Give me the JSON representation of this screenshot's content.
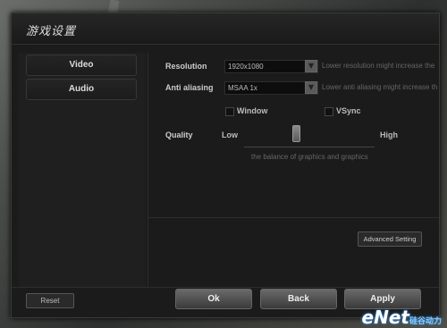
{
  "window": {
    "title": "游戏设置"
  },
  "sidebar": {
    "items": [
      {
        "label": "Video"
      },
      {
        "label": "Audio"
      }
    ]
  },
  "video": {
    "resolution": {
      "label": "Resolution",
      "value": "1920x1080",
      "hint": "Lower resolution might increase the"
    },
    "anti_aliasing": {
      "label": "Anti aliasing",
      "value": "MSAA 1x",
      "hint": "Lower anti aliasing might increase th"
    },
    "window_option": {
      "label": "Window",
      "checked": false
    },
    "vsync_option": {
      "label": "VSync",
      "checked": false
    },
    "quality": {
      "label": "Quality",
      "low": "Low",
      "high": "High",
      "level": 0.4,
      "hint": "the balance of graphics and graphics"
    },
    "advanced_label": "Advanced Setting"
  },
  "footer": {
    "reset_label": "Reset",
    "ok_label": "Ok",
    "back_label": "Back",
    "apply_label": "Apply"
  },
  "watermark": {
    "text": "eNet",
    "sub": "硅谷动力",
    "url": "www.enet.com.cn"
  },
  "colors": {
    "panel": "#1b1b1b",
    "button_grad_top": "#6a6a6a"
  }
}
